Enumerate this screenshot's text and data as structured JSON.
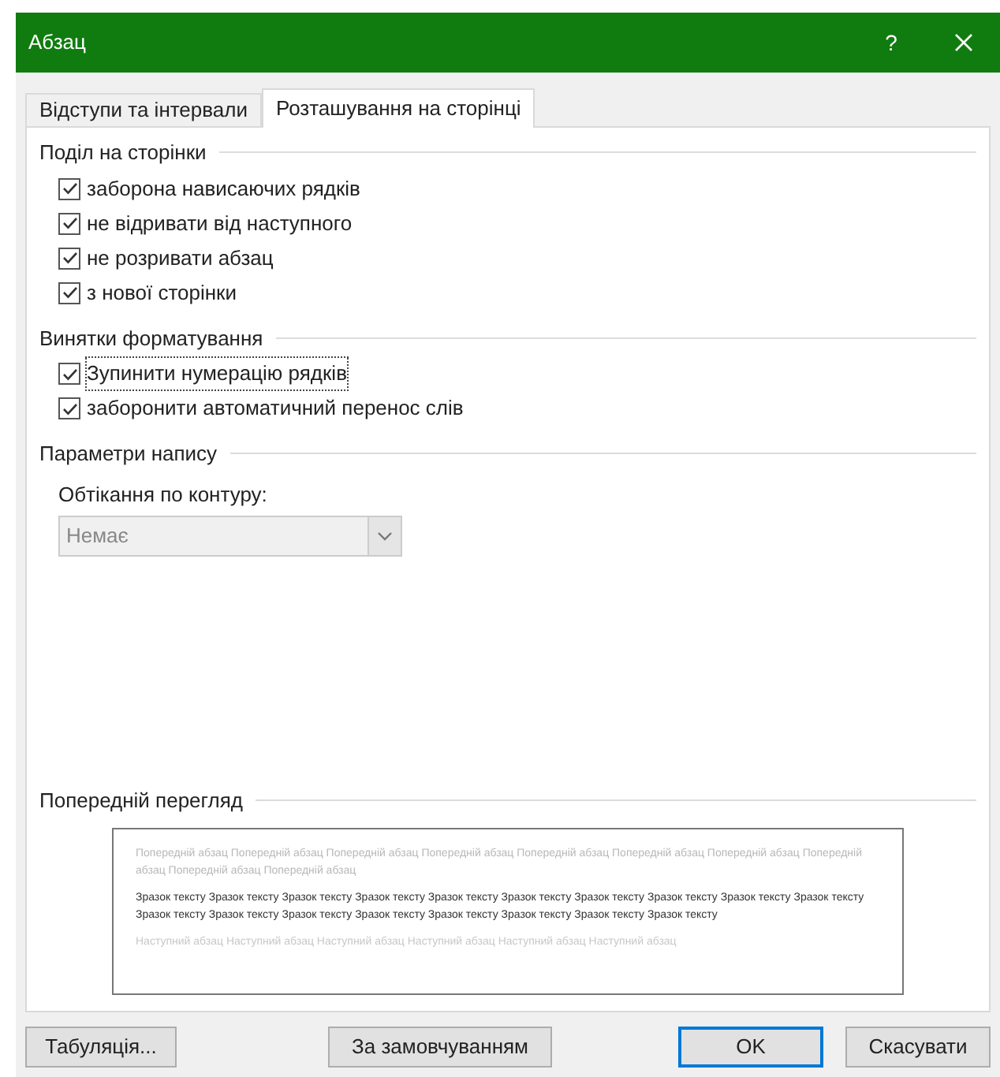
{
  "window": {
    "title": "Абзац",
    "help": "?"
  },
  "tabs": [
    {
      "label": "Відступи та інтервали",
      "selected": false
    },
    {
      "label": "Розташування на сторінці",
      "selected": true
    }
  ],
  "sections": [
    {
      "title": "Поділ на сторінки",
      "options": [
        {
          "label": "заборона нависаючих рядків",
          "checked": true,
          "focused": false
        },
        {
          "label": "не відривати від наступного",
          "checked": true,
          "focused": false
        },
        {
          "label": "не розривати абзац",
          "checked": true,
          "focused": false
        },
        {
          "label": "з нової сторінки",
          "checked": true,
          "focused": false
        }
      ]
    },
    {
      "title": "Винятки форматування",
      "options": [
        {
          "label": "Зупинити нумерацію рядків",
          "checked": true,
          "focused": true
        },
        {
          "label": "заборонити автоматичний перенос слів",
          "checked": true,
          "focused": false
        }
      ]
    }
  ],
  "textbox": {
    "title": "Параметри напису",
    "label": "Обтікання по контуру:",
    "value": "Немає",
    "disabled": true
  },
  "preview": {
    "title": "Попередній перегляд",
    "previous": "Попередній абзац Попередній абзац Попередній абзац Попередній абзац Попередній абзац Попередній абзац Попередній абзац Попередній абзац Попередній абзац Попередній абзац",
    "sample": "Зразок тексту Зразок тексту Зразок тексту Зразок тексту Зразок тексту Зразок тексту Зразок тексту Зразок тексту Зразок тексту Зразок тексту Зразок тексту Зразок тексту Зразок тексту Зразок тексту Зразок тексту Зразок тексту Зразок тексту Зразок тексту",
    "next": "Наступний абзац Наступний абзац Наступний абзац Наступний абзац Наступний абзац Наступний абзац"
  },
  "buttons": [
    {
      "label": "Табуляція...",
      "kind": "left",
      "default": false
    },
    {
      "label": "За замовчуванням",
      "kind": "center",
      "default": false
    },
    {
      "label": "OK",
      "kind": "right",
      "default": true
    },
    {
      "label": "Скасувати",
      "kind": "right",
      "default": false
    }
  ]
}
